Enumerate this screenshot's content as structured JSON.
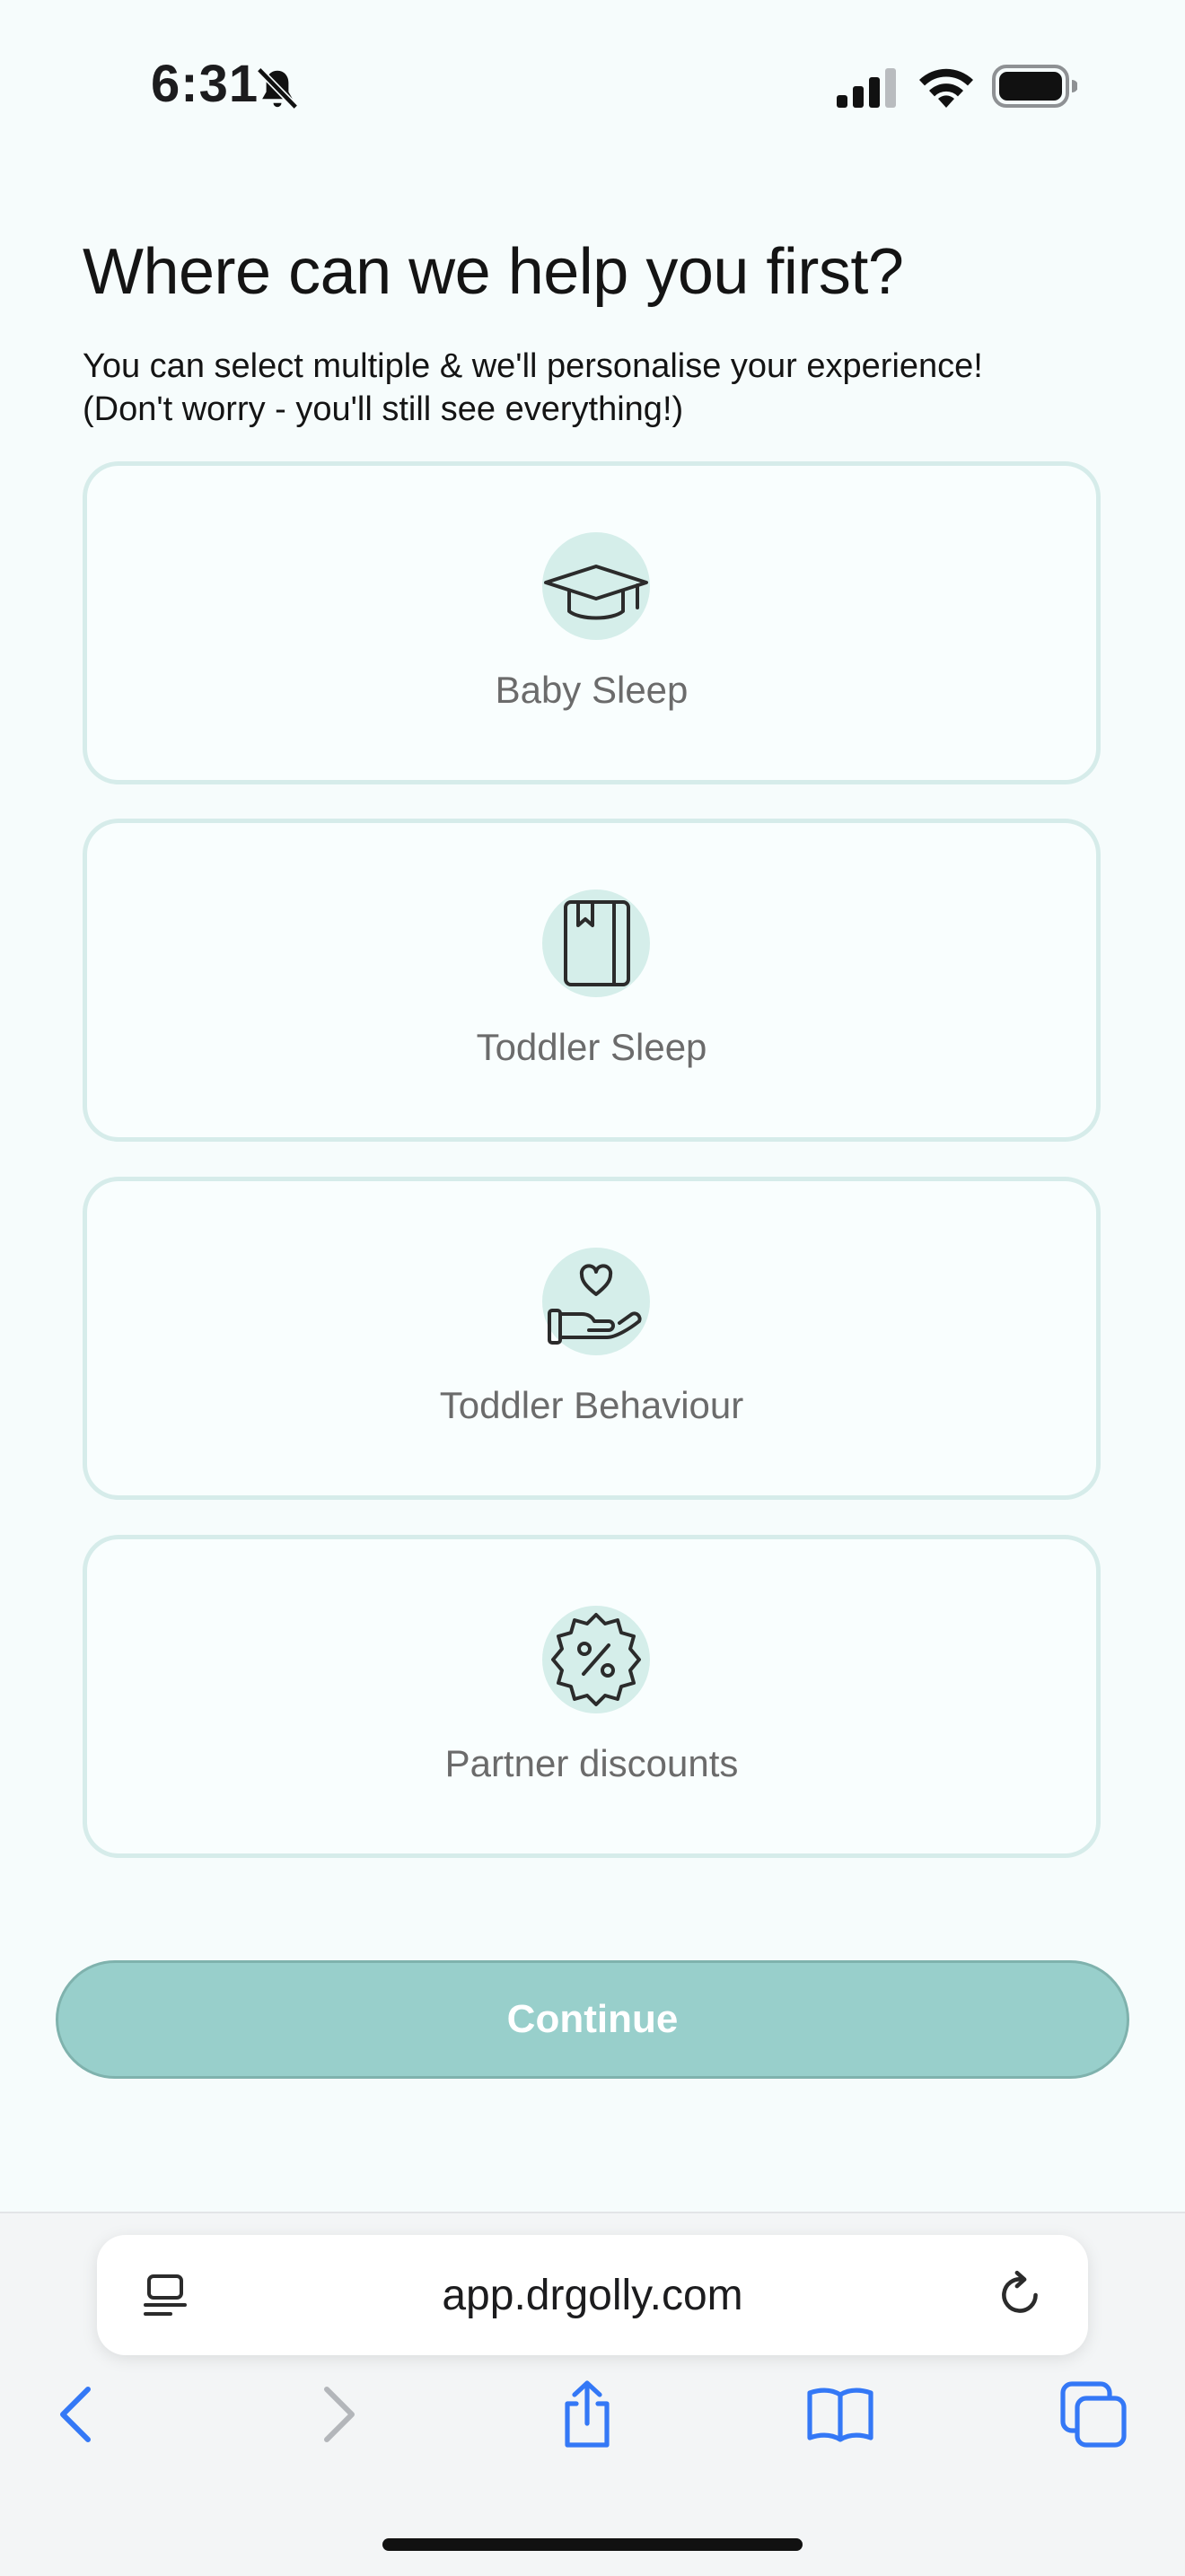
{
  "status_bar": {
    "time": "6:31"
  },
  "title": "Where can we help you first?",
  "subtitle_line1": "You can select multiple & we'll personalise your experience!",
  "subtitle_line2": "(Don't worry - you'll still see everything!)",
  "options": [
    {
      "label": "Baby Sleep",
      "icon": "graduation-cap-icon"
    },
    {
      "label": "Toddler Sleep",
      "icon": "book-icon"
    },
    {
      "label": "Toddler Behaviour",
      "icon": "hand-heart-icon"
    },
    {
      "label": "Partner discounts",
      "icon": "discount-badge-icon"
    }
  ],
  "continue_label": "Continue",
  "browser": {
    "url": "app.drgolly.com"
  },
  "colors": {
    "accent": "#98cfcb",
    "icon_bg": "#d5eeea",
    "card_border": "#d6ecea",
    "browser_blue": "#3478f6"
  }
}
